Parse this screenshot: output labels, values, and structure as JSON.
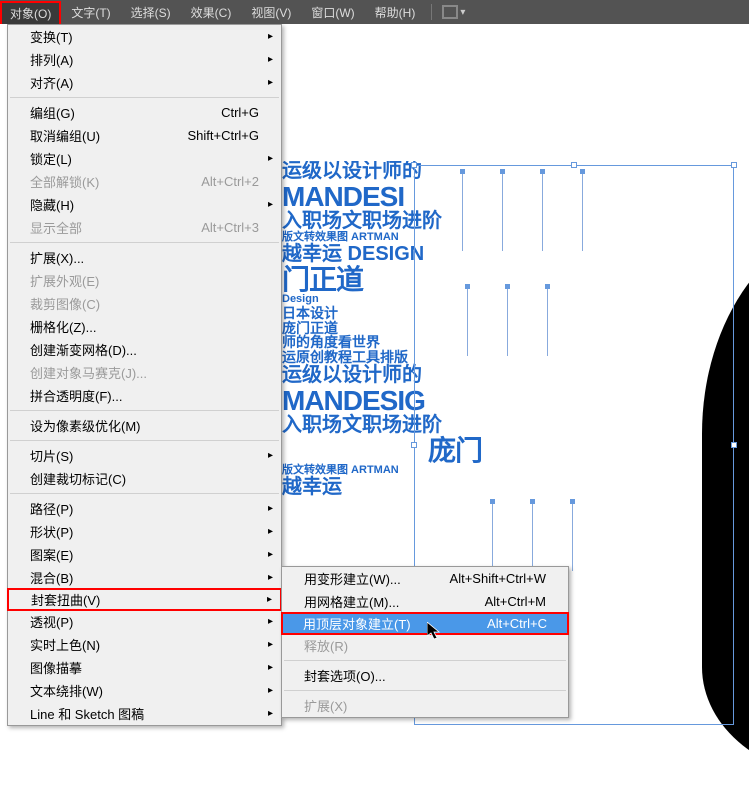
{
  "menubar": {
    "items": [
      "对象(O)",
      "文字(T)",
      "选择(S)",
      "效果(C)",
      "视图(V)",
      "窗口(W)",
      "帮助(H)"
    ]
  },
  "dropdown": [
    {
      "label": "变换(T)",
      "sub": true
    },
    {
      "label": "排列(A)",
      "sub": true
    },
    {
      "label": "对齐(A)",
      "sub": true
    },
    {
      "sep": true
    },
    {
      "label": "编组(G)",
      "shortcut": "Ctrl+G"
    },
    {
      "label": "取消编组(U)",
      "shortcut": "Shift+Ctrl+G"
    },
    {
      "label": "锁定(L)",
      "sub": true
    },
    {
      "label": "全部解锁(K)",
      "shortcut": "Alt+Ctrl+2",
      "disabled": true
    },
    {
      "label": "隐藏(H)",
      "sub": true
    },
    {
      "label": "显示全部",
      "shortcut": "Alt+Ctrl+3",
      "disabled": true
    },
    {
      "sep": true
    },
    {
      "label": "扩展(X)..."
    },
    {
      "label": "扩展外观(E)",
      "disabled": true
    },
    {
      "label": "裁剪图像(C)",
      "disabled": true
    },
    {
      "label": "栅格化(Z)..."
    },
    {
      "label": "创建渐变网格(D)..."
    },
    {
      "label": "创建对象马赛克(J)...",
      "disabled": true
    },
    {
      "label": "拼合透明度(F)..."
    },
    {
      "sep": true
    },
    {
      "label": "设为像素级优化(M)"
    },
    {
      "sep": true
    },
    {
      "label": "切片(S)",
      "sub": true
    },
    {
      "label": "创建裁切标记(C)"
    },
    {
      "sep": true
    },
    {
      "label": "路径(P)",
      "sub": true
    },
    {
      "label": "形状(P)",
      "sub": true
    },
    {
      "label": "图案(E)",
      "sub": true
    },
    {
      "label": "混合(B)",
      "sub": true
    },
    {
      "label": "封套扭曲(V)",
      "sub": true,
      "boxed": true
    },
    {
      "label": "透视(P)",
      "sub": true
    },
    {
      "label": "实时上色(N)",
      "sub": true
    },
    {
      "label": "图像描摹",
      "sub": true
    },
    {
      "label": "文本绕排(W)",
      "sub": true
    },
    {
      "label": "Line 和 Sketch 图稿",
      "sub": true
    }
  ],
  "submenu": [
    {
      "label": "用变形建立(W)...",
      "shortcut": "Alt+Shift+Ctrl+W"
    },
    {
      "label": "用网格建立(M)...",
      "shortcut": "Alt+Ctrl+M"
    },
    {
      "label": "用顶层对象建立(T)",
      "shortcut": "Alt+Ctrl+C",
      "highlighted": true
    },
    {
      "label": "释放(R)",
      "disabled": true
    },
    {
      "sep": true
    },
    {
      "label": "封套选项(O)..."
    },
    {
      "sep": true
    },
    {
      "label": "扩展(X)",
      "disabled": true
    }
  ],
  "canvas_text": {
    "l1": "运级以设计师的",
    "l2": "MANDESI",
    "l3": "入职场文职场进阶",
    "l4": "版文转效果图 ARTMAN",
    "l5": "越幸运 DESIGN",
    "l6": "门正道",
    "l7": "Design",
    "l8": "日本设计",
    "l9": "庞门正道",
    "l10": "师的角度看世界",
    "l11": "运原创教程工具排版",
    "l12": "运级以设计师的",
    "l13": "MANDESIG",
    "l14": "入职场文职场进阶",
    "l15": "庞门",
    "l16": "版文转效果图 ARTMAN",
    "l17": "越幸运"
  }
}
